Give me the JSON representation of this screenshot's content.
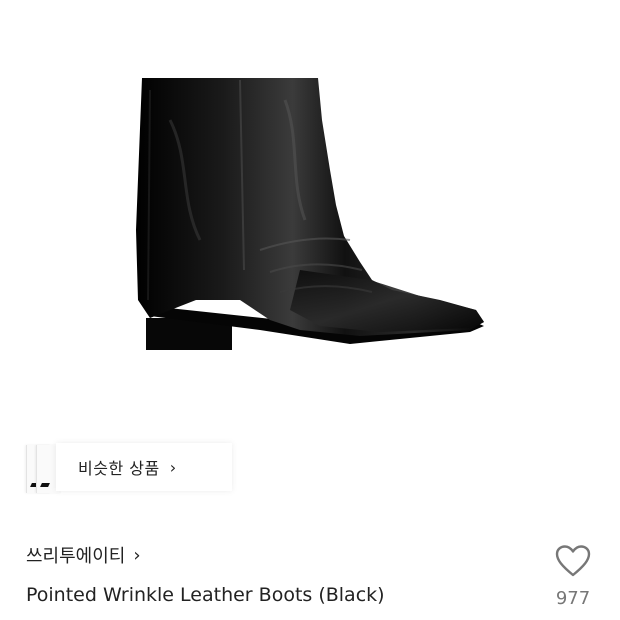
{
  "similar": {
    "label": "비슷한 상품",
    "chevron_icon": "chevron-right-icon"
  },
  "brand": {
    "name": "쓰리투에이티",
    "chevron_icon": "chevron-right-icon"
  },
  "product": {
    "title": "Pointed Wrinkle Leather Boots (Black)",
    "image_icon": "black-ankle-boot-photo"
  },
  "like": {
    "icon": "heart-outline-icon",
    "count": "977"
  },
  "colors": {
    "boot": "#0b0b0b",
    "text": "#222222",
    "muted": "#777777"
  }
}
